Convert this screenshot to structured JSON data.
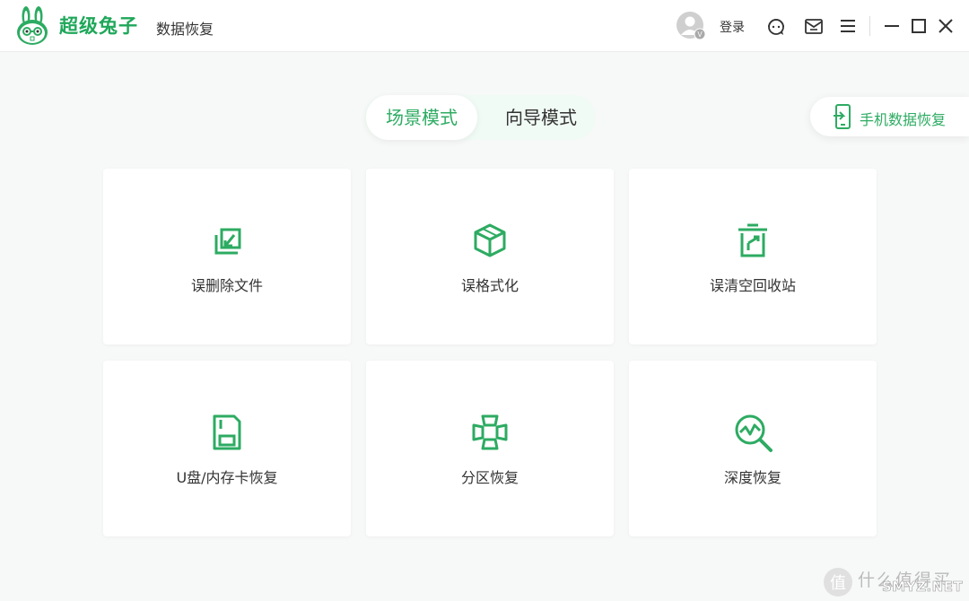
{
  "app": {
    "name": "超级兔子",
    "subtitle": "数据恢复"
  },
  "titlebar": {
    "login_label": "登录",
    "icons": [
      "avatar-icon",
      "support-icon",
      "message-icon",
      "menu-icon",
      "minimize-icon",
      "maximize-icon",
      "close-icon"
    ]
  },
  "mode_tabs": [
    {
      "label": "场景模式",
      "active": true
    },
    {
      "label": "向导模式",
      "active": false
    }
  ],
  "phone_recovery": {
    "label": "手机数据恢复"
  },
  "cards": [
    {
      "label": "误删除文件",
      "icon": "deleted-file-icon"
    },
    {
      "label": "误格式化",
      "icon": "format-cube-icon"
    },
    {
      "label": "误清空回收站",
      "icon": "recycle-bin-icon"
    },
    {
      "label": "U盘/内存卡恢复",
      "icon": "usb-card-icon"
    },
    {
      "label": "分区恢复",
      "icon": "partition-icon"
    },
    {
      "label": "深度恢复",
      "icon": "deep-scan-icon"
    }
  ],
  "watermark": {
    "text": "什么值得买",
    "sub": "SMYZ.NET"
  },
  "colors": {
    "accent": "#2dab62",
    "background": "#f7f8f8"
  }
}
